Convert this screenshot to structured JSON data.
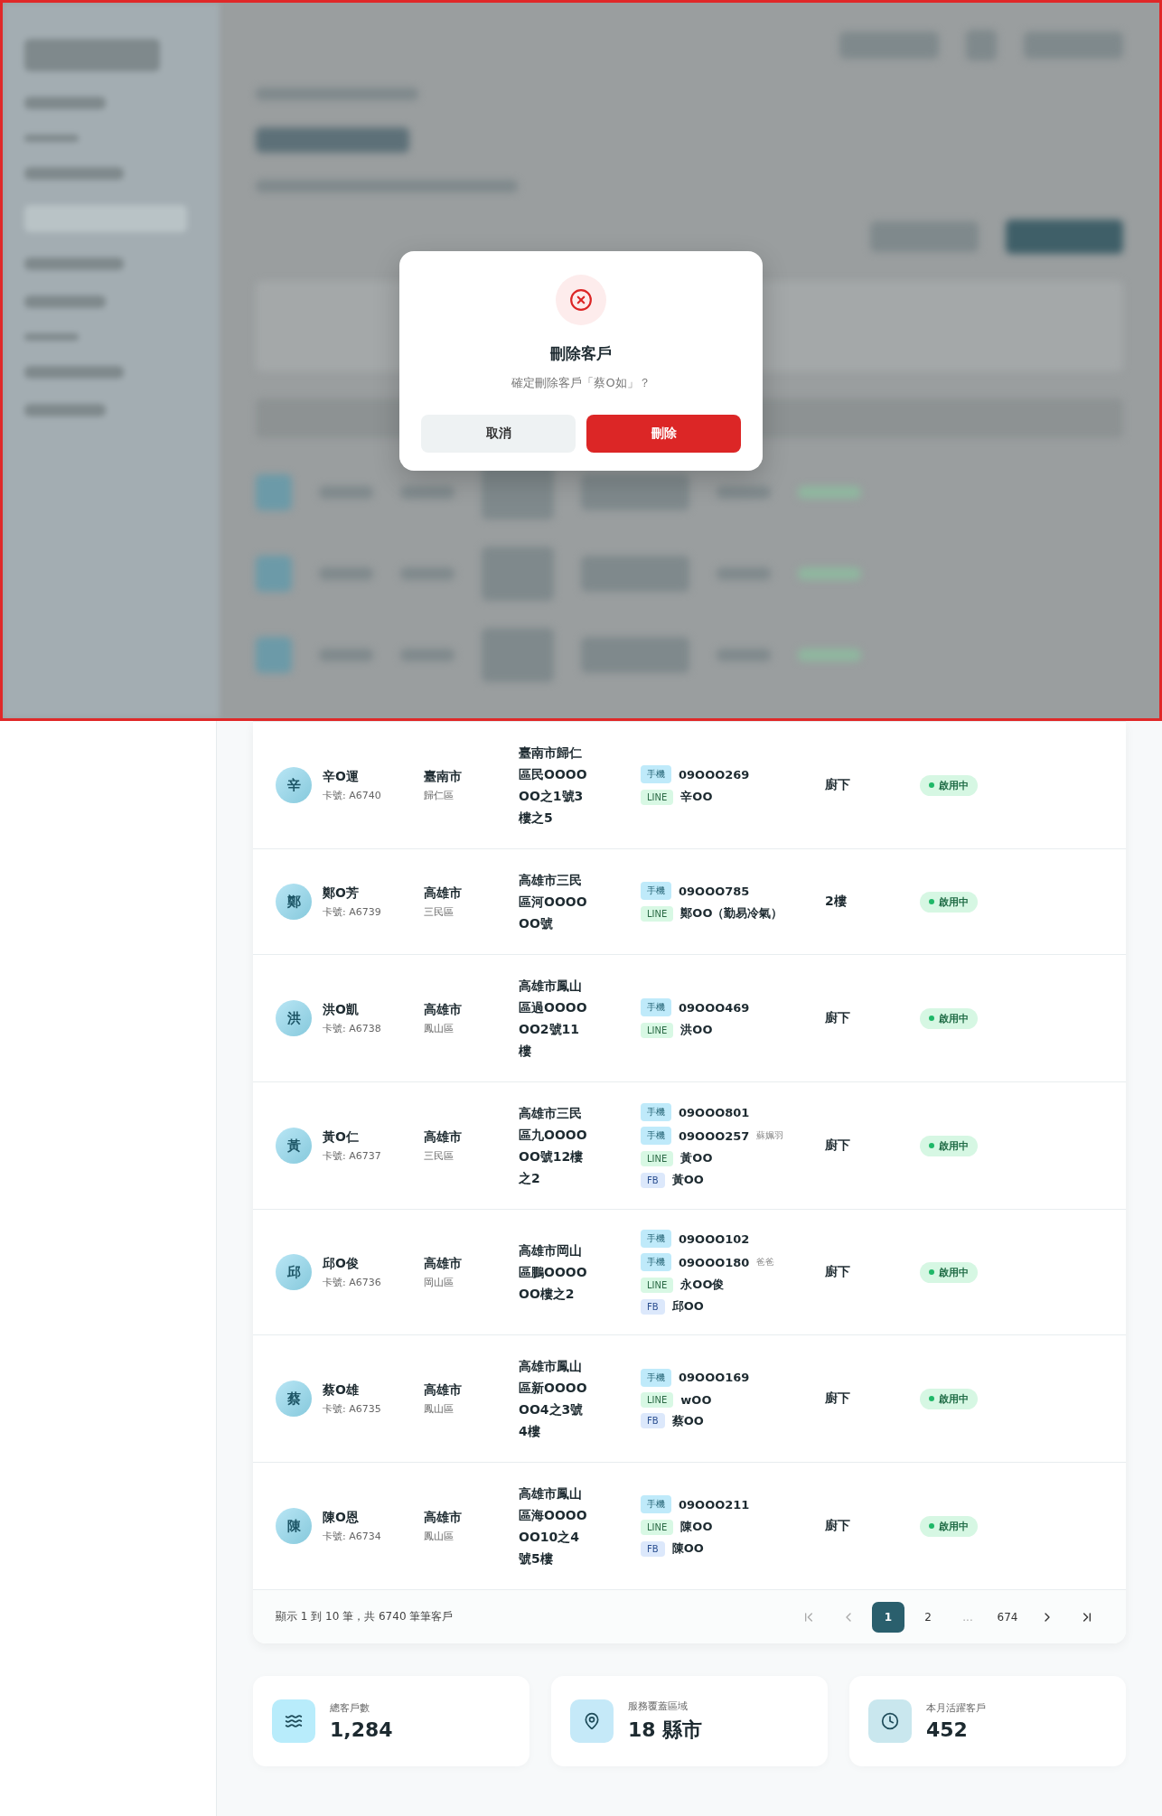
{
  "dialog": {
    "title": "刪除客戶",
    "message": "確定刪除客戶「蔡O如」？",
    "buttons": [
      {
        "label": "取消",
        "kind": "cancel"
      },
      {
        "label": "刪除",
        "kind": "danger"
      }
    ]
  },
  "table": {
    "rows": [
      {
        "avatar": "辛",
        "name": "辛O運",
        "card": "卡號: A6740",
        "city": "臺南市",
        "district": "歸仁區",
        "address": "臺南市歸仁區民OOOOOO之1號3樓之5",
        "contacts": [
          {
            "kind": "phone",
            "tag": "手機",
            "value": "09OOO269"
          },
          {
            "kind": "line",
            "tag": "LINE",
            "value": "辛OO"
          }
        ],
        "location": "廚下",
        "status": {
          "label": "啟用中",
          "active": true
        }
      },
      {
        "avatar": "鄭",
        "name": "鄭O芳",
        "card": "卡號: A6739",
        "city": "高雄市",
        "district": "三民區",
        "address": "高雄市三民區河OOOOOO號",
        "contacts": [
          {
            "kind": "phone",
            "tag": "手機",
            "value": "09OOO785"
          },
          {
            "kind": "line",
            "tag": "LINE",
            "value": "鄭OO（勤易冷氣）"
          }
        ],
        "location": "2樓",
        "status": {
          "label": "啟用中",
          "active": true
        }
      },
      {
        "avatar": "洪",
        "name": "洪O凱",
        "card": "卡號: A6738",
        "city": "高雄市",
        "district": "鳳山區",
        "address": "高雄市鳳山區過OOOOOO2號11樓",
        "contacts": [
          {
            "kind": "phone",
            "tag": "手機",
            "value": "09OOO469"
          },
          {
            "kind": "line",
            "tag": "LINE",
            "value": "洪OO"
          }
        ],
        "location": "廚下",
        "status": {
          "label": "啟用中",
          "active": true
        }
      },
      {
        "avatar": "黃",
        "name": "黃O仁",
        "card": "卡號: A6737",
        "city": "高雄市",
        "district": "三民區",
        "address": "高雄市三民區九OOOOOO號12樓之2",
        "contacts": [
          {
            "kind": "phone",
            "tag": "手機",
            "value": "09OOO801"
          },
          {
            "kind": "phone",
            "tag": "手機",
            "value": "09OOO257",
            "note": "蘇姵羽"
          },
          {
            "kind": "line",
            "tag": "LINE",
            "value": "黃OO"
          },
          {
            "kind": "fb",
            "tag": "FB",
            "value": "黃OO"
          }
        ],
        "location": "廚下",
        "status": {
          "label": "啟用中",
          "active": true
        }
      },
      {
        "avatar": "邱",
        "name": "邱O俊",
        "card": "卡號: A6736",
        "city": "高雄市",
        "district": "岡山區",
        "address": "高雄市岡山區鵬OOOOOO樓之2",
        "contacts": [
          {
            "kind": "phone",
            "tag": "手機",
            "value": "09OOO102"
          },
          {
            "kind": "phone",
            "tag": "手機",
            "value": "09OOO180",
            "note": "爸爸"
          },
          {
            "kind": "line",
            "tag": "LINE",
            "value": "永OO俊"
          },
          {
            "kind": "fb",
            "tag": "FB",
            "value": "邱OO"
          }
        ],
        "location": "廚下",
        "status": {
          "label": "啟用中",
          "active": true
        }
      },
      {
        "avatar": "蔡",
        "name": "蔡O雄",
        "card": "卡號: A6735",
        "city": "高雄市",
        "district": "鳳山區",
        "address": "高雄市鳳山區新OOOOOO4之3號4樓",
        "contacts": [
          {
            "kind": "phone",
            "tag": "手機",
            "value": "09OOO169"
          },
          {
            "kind": "line",
            "tag": "LINE",
            "value": "wOO"
          },
          {
            "kind": "fb",
            "tag": "FB",
            "value": "蔡OO"
          }
        ],
        "location": "廚下",
        "status": {
          "label": "啟用中",
          "active": true
        }
      },
      {
        "avatar": "陳",
        "name": "陳O恩",
        "card": "卡號: A6734",
        "city": "高雄市",
        "district": "鳳山區",
        "address": "高雄市鳳山區海OOOOOO10之4號5樓",
        "contacts": [
          {
            "kind": "phone",
            "tag": "手機",
            "value": "09OOO211"
          },
          {
            "kind": "line",
            "tag": "LINE",
            "value": "陳OO"
          },
          {
            "kind": "fb",
            "tag": "FB",
            "value": "陳OO"
          }
        ],
        "location": "廚下",
        "status": {
          "label": "啟用中",
          "active": true
        }
      }
    ]
  },
  "pagination": {
    "summary": "顯示 1 到 10 筆，共 6740 筆筆客戶",
    "pages": [
      {
        "kind": "page",
        "label": "1",
        "selected": true
      },
      {
        "kind": "page",
        "label": "2",
        "selected": false
      },
      {
        "kind": "ellipsis",
        "label": "..."
      },
      {
        "kind": "page",
        "label": "674",
        "selected": false
      }
    ]
  },
  "stats": [
    {
      "kind": "customers",
      "label": "總客戶數",
      "value": "1,284"
    },
    {
      "kind": "area",
      "label": "服務覆蓋區域",
      "value": "18 縣市"
    },
    {
      "kind": "active",
      "label": "本月活躍客戶",
      "value": "452"
    }
  ]
}
